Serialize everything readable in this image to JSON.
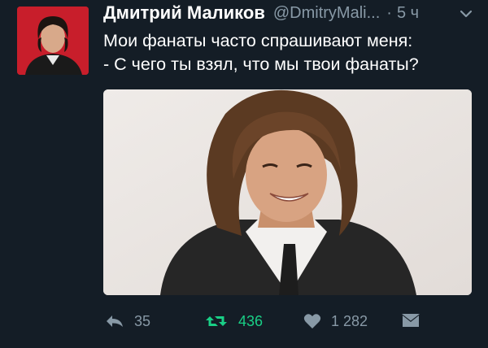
{
  "tweet": {
    "author_name": "Дмитрий Маликов",
    "handle": "@DmitryMali...",
    "separator": "·",
    "time": "5 ч",
    "text_lines": [
      "Мои фанаты часто спрашивают меня:",
      "- С чего ты взял, что мы твои фанаты?"
    ]
  },
  "actions": {
    "reply_count": "35",
    "retweet_count": "436",
    "like_count": "1 282"
  },
  "icons": {
    "menu": "chevron-down-icon",
    "reply": "reply-icon",
    "retweet": "retweet-icon",
    "like": "heart-icon",
    "dm": "direct-message-icon"
  },
  "colors": {
    "background": "#141d26",
    "secondary_text": "#8899a6",
    "retweet_active": "#19cf86"
  }
}
